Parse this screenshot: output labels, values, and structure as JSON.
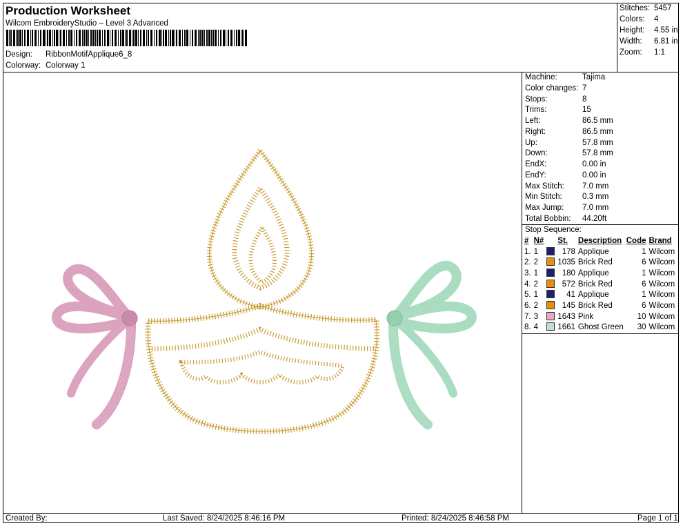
{
  "header": {
    "title": "Production Worksheet",
    "software": "Wilcom EmbroideryStudio – Level 3 Advanced",
    "design_label": "Design:",
    "design_value": "RibbonMotifApplique6_8",
    "colorway_label": "Colorway:",
    "colorway_value": "Colorway 1"
  },
  "summary": [
    {
      "label": "Stitches:",
      "value": "5457"
    },
    {
      "label": "Colors:",
      "value": "4"
    },
    {
      "label": "Height:",
      "value": "4.55 in"
    },
    {
      "label": "Width:",
      "value": "6.81 in"
    },
    {
      "label": "Zoom:",
      "value": "1:1"
    }
  ],
  "machine_info": [
    {
      "label": "Machine:",
      "value": "Tajima"
    },
    {
      "label": "Color changes:",
      "value": "7"
    },
    {
      "label": "Stops:",
      "value": "8"
    },
    {
      "label": "Trims:",
      "value": "15"
    },
    {
      "label": "Left:",
      "value": "86.5 mm"
    },
    {
      "label": "Right:",
      "value": "86.5 mm"
    },
    {
      "label": "Up:",
      "value": "57.8 mm"
    },
    {
      "label": "Down:",
      "value": "57.8 mm"
    },
    {
      "label": "EndX:",
      "value": "0.00 in"
    },
    {
      "label": "EndY:",
      "value": "0.00 in"
    },
    {
      "label": "Max Stitch:",
      "value": "7.0 mm"
    },
    {
      "label": "Min Stitch:",
      "value": "0.3 mm"
    },
    {
      "label": "Max Jump:",
      "value": "7.0 mm"
    },
    {
      "label": "Total Bobbin:",
      "value": "44.20ft"
    }
  ],
  "stop_sequence": {
    "title": "Stop Sequence:",
    "headers": {
      "num": "#",
      "n": "N#",
      "st": "St.",
      "desc": "Description",
      "code": "Code",
      "brand": "Brand"
    },
    "rows": [
      {
        "num": "1.",
        "n": "1",
        "color": "#1f1f6e",
        "st": "178",
        "desc": "Applique",
        "code": "1",
        "brand": "Wilcom"
      },
      {
        "num": "2.",
        "n": "2",
        "color": "#e8900a",
        "st": "1035",
        "desc": "Brick Red",
        "code": "6",
        "brand": "Wilcom"
      },
      {
        "num": "3.",
        "n": "1",
        "color": "#1f1f6e",
        "st": "180",
        "desc": "Applique",
        "code": "1",
        "brand": "Wilcom"
      },
      {
        "num": "4.",
        "n": "2",
        "color": "#e8900a",
        "st": "572",
        "desc": "Brick Red",
        "code": "6",
        "brand": "Wilcom"
      },
      {
        "num": "5.",
        "n": "1",
        "color": "#1f1f6e",
        "st": "41",
        "desc": "Applique",
        "code": "1",
        "brand": "Wilcom"
      },
      {
        "num": "6.",
        "n": "2",
        "color": "#e8900a",
        "st": "145",
        "desc": "Brick Red",
        "code": "6",
        "brand": "Wilcom"
      },
      {
        "num": "7.",
        "n": "3",
        "color": "#e9a6c8",
        "st": "1643",
        "desc": "Pink",
        "code": "10",
        "brand": "Wilcom"
      },
      {
        "num": "8.",
        "n": "4",
        "color": "#bfe0cc",
        "st": "1661",
        "desc": "Ghost Green",
        "code": "30",
        "brand": "Wilcom"
      }
    ]
  },
  "footer": {
    "created_by": "Created By:",
    "last_saved": "Last Saved: 8/24/2025 8:46:16 PM",
    "printed": "Printed: 8/24/2025 8:46:58 PM",
    "page": "Page 1 of 1"
  },
  "design_colors": {
    "gold": "#c99a2e",
    "pink": "#dca3bf",
    "pink_dark": "#b8789a",
    "green": "#a9dcc0",
    "green_dark": "#7dbb99"
  }
}
